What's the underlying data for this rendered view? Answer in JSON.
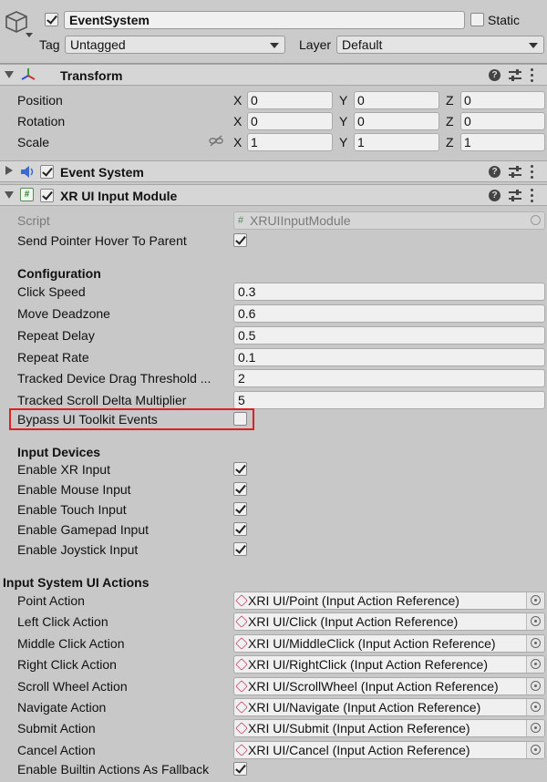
{
  "gameobject": {
    "name": "EventSystem",
    "static_label": "Static",
    "tag_label": "Tag",
    "tag_value": "Untagged",
    "layer_label": "Layer",
    "layer_value": "Default"
  },
  "transform": {
    "title": "Transform",
    "rows": [
      {
        "label": "Position",
        "x": "0",
        "y": "0",
        "z": "0"
      },
      {
        "label": "Rotation",
        "x": "0",
        "y": "0",
        "z": "0"
      },
      {
        "label": "Scale",
        "x": "1",
        "y": "1",
        "z": "1"
      }
    ],
    "axis_x": "X",
    "axis_y": "Y",
    "axis_z": "Z"
  },
  "event_system": {
    "title": "Event System"
  },
  "xr_module": {
    "title": "XR UI Input Module",
    "script_label": "Script",
    "script_value": "XRUIInputModule",
    "send_hover_label": "Send Pointer Hover To Parent",
    "configuration": {
      "header": "Configuration",
      "fields": [
        {
          "label": "Click Speed",
          "value": "0.3"
        },
        {
          "label": "Move Deadzone",
          "value": "0.6"
        },
        {
          "label": "Repeat Delay",
          "value": "0.5"
        },
        {
          "label": "Repeat Rate",
          "value": "0.1"
        },
        {
          "label": "Tracked Device Drag Threshold ...",
          "value": "2"
        },
        {
          "label": "Tracked Scroll Delta Multiplier",
          "value": "5"
        }
      ],
      "bypass_label": "Bypass UI Toolkit Events"
    },
    "input_devices": {
      "header": "Input Devices",
      "items": [
        {
          "label": "Enable XR Input"
        },
        {
          "label": "Enable Mouse Input"
        },
        {
          "label": "Enable Touch Input"
        },
        {
          "label": "Enable Gamepad Input"
        },
        {
          "label": "Enable Joystick Input"
        }
      ]
    },
    "actions": {
      "header": "Input System UI Actions",
      "items": [
        {
          "label": "Point Action",
          "value": "XRI UI/Point (Input Action Reference)"
        },
        {
          "label": "Left Click Action",
          "value": "XRI UI/Click (Input Action Reference)"
        },
        {
          "label": "Middle Click Action",
          "value": "XRI UI/MiddleClick (Input Action Reference)"
        },
        {
          "label": "Right Click Action",
          "value": "XRI UI/RightClick (Input Action Reference)"
        },
        {
          "label": "Scroll Wheel Action",
          "value": "XRI UI/ScrollWheel (Input Action Reference)"
        },
        {
          "label": "Navigate Action",
          "value": "XRI UI/Navigate (Input Action Reference)"
        },
        {
          "label": "Submit Action",
          "value": "XRI UI/Submit (Input Action Reference)"
        },
        {
          "label": "Cancel Action",
          "value": "XRI UI/Cancel (Input Action Reference)"
        }
      ],
      "fallback_label": "Enable Builtin Actions As Fallback"
    }
  },
  "help_glyph": "?",
  "colors": {
    "highlight": "#e02020",
    "background": "#c8c8c8"
  }
}
